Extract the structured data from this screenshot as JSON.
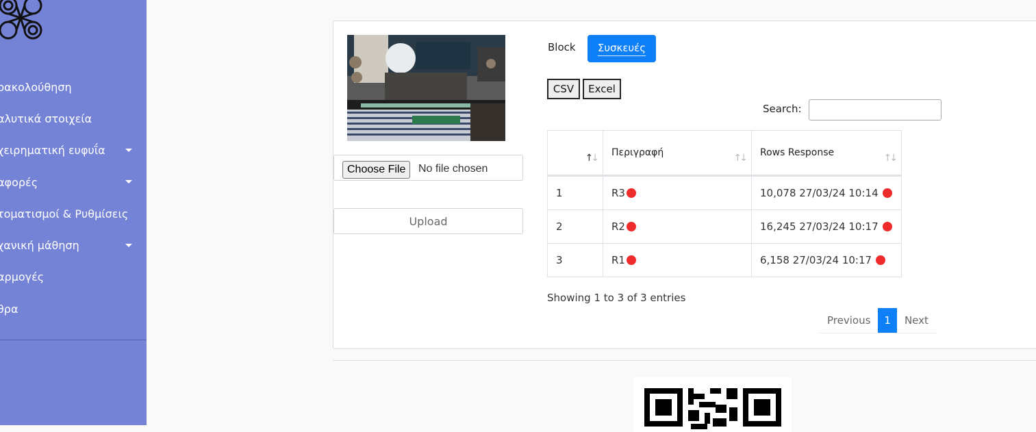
{
  "sidebar": {
    "items": [
      {
        "label": "ρακολούθηση",
        "has_caret": false
      },
      {
        "label": "αλυτικά στοιχεία",
        "has_caret": false
      },
      {
        "label": "χειρηματική ευφυΐα",
        "has_caret": true
      },
      {
        "label": "αφορές",
        "has_caret": true
      },
      {
        "label": "τοματισμοί & Ρυθμίσεις",
        "has_caret": false
      },
      {
        "label": "χανική μάθηση",
        "has_caret": true
      },
      {
        "label": "αρμογές",
        "has_caret": false
      },
      {
        "label": "θρα",
        "has_caret": false
      }
    ]
  },
  "upload": {
    "choose_label": "Choose File",
    "status": "No file chosen",
    "upload_label": "Upload"
  },
  "tabs": {
    "block": "Block",
    "devices": "Συσκευές"
  },
  "export": {
    "csv": "CSV",
    "excel": "Excel"
  },
  "search": {
    "label": "Search:",
    "value": ""
  },
  "table": {
    "headers": [
      "",
      "Περιγραφή",
      "Rows Response"
    ],
    "rows": [
      {
        "num": "1",
        "desc": "R3",
        "response": "10,078 27/03/24 10:14"
      },
      {
        "num": "2",
        "desc": "R2",
        "response": "16,245 27/03/24 10:17"
      },
      {
        "num": "3",
        "desc": "R1",
        "response": "6,158 27/03/24 10:17"
      }
    ],
    "status_color": "#f02b2b"
  },
  "info": "Showing 1 to 3 of 3 entries",
  "pagination": {
    "previous": "Previous",
    "current": "1",
    "next": "Next"
  },
  "colors": {
    "sidebar_bg": "#7483d5",
    "accent": "#0d7ff7"
  }
}
